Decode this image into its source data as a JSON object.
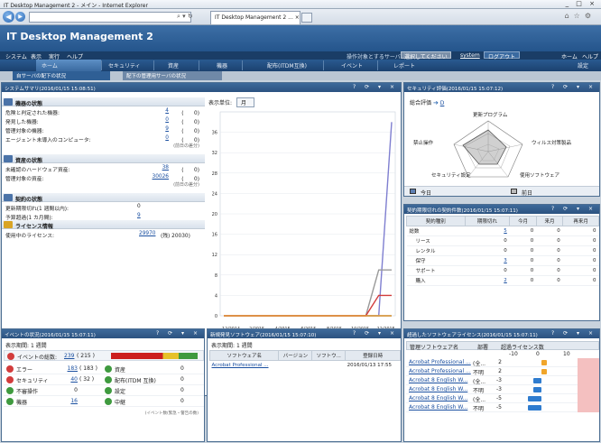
{
  "browser": {
    "title": "IT Desktop Management 2 - メイン - Internet Explorer",
    "window_controls": "_ □ ×",
    "tab_label": "IT Desktop Management 2 ... ×"
  },
  "app": {
    "title": "IT Desktop Management 2",
    "menu": [
      "システム",
      "表示",
      "実行",
      "ヘルプ"
    ],
    "target_label": "操作対象とするサーバ",
    "target_select": "選択してください",
    "user_label": "system",
    "logout": "ログアウト",
    "home": "ホーム",
    "help": "ヘルプ",
    "toolbar": [
      "ホーム",
      "セキュリティ",
      "資産",
      "機器",
      "配布(ITDM互換)",
      "イベント",
      "レポート",
      "設定"
    ],
    "subtabs": [
      "自サーバの配下の状況",
      "配下の管理用サーバの状況"
    ]
  },
  "system_summary": {
    "title": "システムサマリ(2016/01/15 15:08:51)",
    "unit_label": "表示単位:",
    "unit_value": "月",
    "devices": {
      "heading": "機器の状態",
      "rows": [
        {
          "label": "危険と判定された機器:",
          "value": "4",
          "paren": "(　　0)"
        },
        {
          "label": "発見した機器:",
          "value": "0",
          "paren": "(　　0)"
        },
        {
          "label": "管理対象の機器:",
          "value": "9",
          "paren": "(　　0)"
        },
        {
          "label": "エージェント未導入のコンピュータ:",
          "value": "0",
          "paren": "(　　0)"
        }
      ],
      "note": "(前日の差分)"
    },
    "assets": {
      "heading": "資産の状態",
      "rows": [
        {
          "label": "未確認のハードウェア資産:",
          "value": "38",
          "paren": "(　　0)"
        },
        {
          "label": "管理対象の資産:",
          "value": "30026",
          "paren": "(　　0)"
        }
      ],
      "note": "(前日の差分)"
    },
    "contracts": {
      "heading": "契約の状態",
      "rows": [
        {
          "label": "更新期限切れ(1 週間以内):",
          "value": "0"
        },
        {
          "label": "予算超過(1 カ月間):",
          "value": "9"
        }
      ]
    },
    "license": {
      "heading": "ライセンス情報",
      "label": "使用中のライセンス:",
      "value": "29970",
      "extra": "(残) 20030)"
    }
  },
  "chart_data": {
    "type": "line",
    "x": [
      "12/2014",
      "2/2015",
      "4/2015",
      "6/2015",
      "8/2015",
      "10/2015",
      "12/2015"
    ],
    "ylim": [
      0,
      40
    ],
    "yticks": [
      0,
      4,
      8,
      12,
      16,
      20,
      24,
      28,
      32,
      36
    ],
    "series": [
      {
        "name": "未確認のハードウェア資産",
        "color": "#7f7fd0",
        "values": [
          0,
          0,
          0,
          0,
          0,
          0,
          0,
          0,
          0,
          0,
          0,
          0,
          0,
          38
        ]
      },
      {
        "name": "エージェント未導入のコンピュ",
        "color": "#4e8a4e",
        "values": [
          0,
          0,
          0,
          0,
          0,
          0,
          0,
          0,
          0,
          0,
          0,
          0,
          0,
          0
        ]
      },
      {
        "name": "管理対象の機器",
        "color": "#999999",
        "values": [
          0,
          0,
          0,
          0,
          0,
          0,
          0,
          0,
          0,
          0,
          0,
          0,
          9,
          9
        ]
      },
      {
        "name": "管理対象の資産",
        "color": "#bbbbbb",
        "values": [
          0,
          0,
          0,
          0,
          0,
          0,
          0,
          0,
          0,
          0,
          0,
          0,
          0,
          0
        ]
      },
      {
        "name": "危険と判定された機器",
        "color": "#d23c3c",
        "values": [
          0,
          0,
          0,
          0,
          0,
          0,
          0,
          0,
          0,
          0,
          0,
          0,
          4,
          4
        ]
      },
      {
        "name": "発見した機器",
        "color": "#e89a3a",
        "values": [
          0,
          0,
          0,
          0,
          0,
          0,
          0,
          0,
          0,
          0,
          0,
          0,
          0,
          0
        ]
      }
    ]
  },
  "security_eval": {
    "title": "セキュリティ評価(2016/01/15 15:07:12)",
    "overall_label": "総合評価",
    "overall_value": "D",
    "axes": [
      "更新プログラム",
      "ウィルス対策製品",
      "使用ソフトウェア",
      "セキュリティ設定",
      "禁止操作"
    ],
    "legend_today": "今日",
    "legend_prev": "前日"
  },
  "contract_panel": {
    "title": "契約期限切れの契約件数(2016/01/15 15:07:11)",
    "headers": [
      "契約種別",
      "期限切れ",
      "今月",
      "来月",
      "再来月"
    ],
    "rows": [
      [
        "総数",
        "5",
        "0",
        "0",
        "0"
      ],
      [
        "リース",
        "0",
        "0",
        "0",
        "0"
      ],
      [
        "レンタル",
        "0",
        "0",
        "0",
        "0"
      ],
      [
        "保守",
        "3",
        "0",
        "0",
        "0"
      ],
      [
        "サポート",
        "0",
        "0",
        "0",
        "0"
      ],
      [
        "購入",
        "2",
        "0",
        "0",
        "0"
      ]
    ]
  },
  "event_panel": {
    "title": "イベントの状況(2016/01/15 15:07:11)",
    "period_label": "表示期間:",
    "period_value": "1 週間",
    "total_label": "イベントの総数:",
    "total_value": "239",
    "total_paren": "( 215 )",
    "rows": [
      {
        "l1": "エラー",
        "v1": "183",
        "p1": "( 183 )",
        "l2": "資産",
        "v2": "0"
      },
      {
        "l1": "セキュリティ",
        "v1": "40",
        "p1": "( 32 )",
        "l2": "配布(ITDM 互換)",
        "v2": "0"
      },
      {
        "l1": "不審操作",
        "v1": "0",
        "p1": "",
        "l2": "設定",
        "v2": "0"
      },
      {
        "l1": "機器",
        "v1": "16",
        "p1": "",
        "l2": "中継",
        "v2": "0"
      }
    ],
    "note": "(イベント数(緊急・警告の数)"
  },
  "newsoft_panel": {
    "title": "新規発見ソフトウェア(2016/01/15 15:07:10)",
    "period_label": "表示期間:",
    "period_value": "1 週間",
    "headers": [
      "ソフトウェア名",
      "バージョン",
      "ソフトウ...",
      "登録日時"
    ],
    "rows": [
      [
        "Acrobat Professional ...",
        "",
        "",
        "2016/01/13 17:55"
      ]
    ]
  },
  "overlicense_panel": {
    "title": "超過したソフトウェアライセンス(2016/01/15 15:07:11)",
    "headers": [
      "管理ソフトウェア名",
      "部署",
      "超過ライセンス数"
    ],
    "axis": [
      "-10",
      "0",
      "10"
    ],
    "rows": [
      {
        "name": "Acrobat Professional ...",
        "dept": "(全...",
        "value": "2"
      },
      {
        "name": "Acrobat Professional ...",
        "dept": "不明",
        "value": "2"
      },
      {
        "name": "Acrobat 8 English W...",
        "dept": "(全...",
        "value": "-3"
      },
      {
        "name": "Acrobat 8 English W...",
        "dept": "不明",
        "value": "-3"
      },
      {
        "name": "Acrobat 8 English W...",
        "dept": "(全...",
        "value": "-5"
      },
      {
        "name": "Acrobat 8 English W...",
        "dept": "不明",
        "value": "-5"
      }
    ]
  }
}
